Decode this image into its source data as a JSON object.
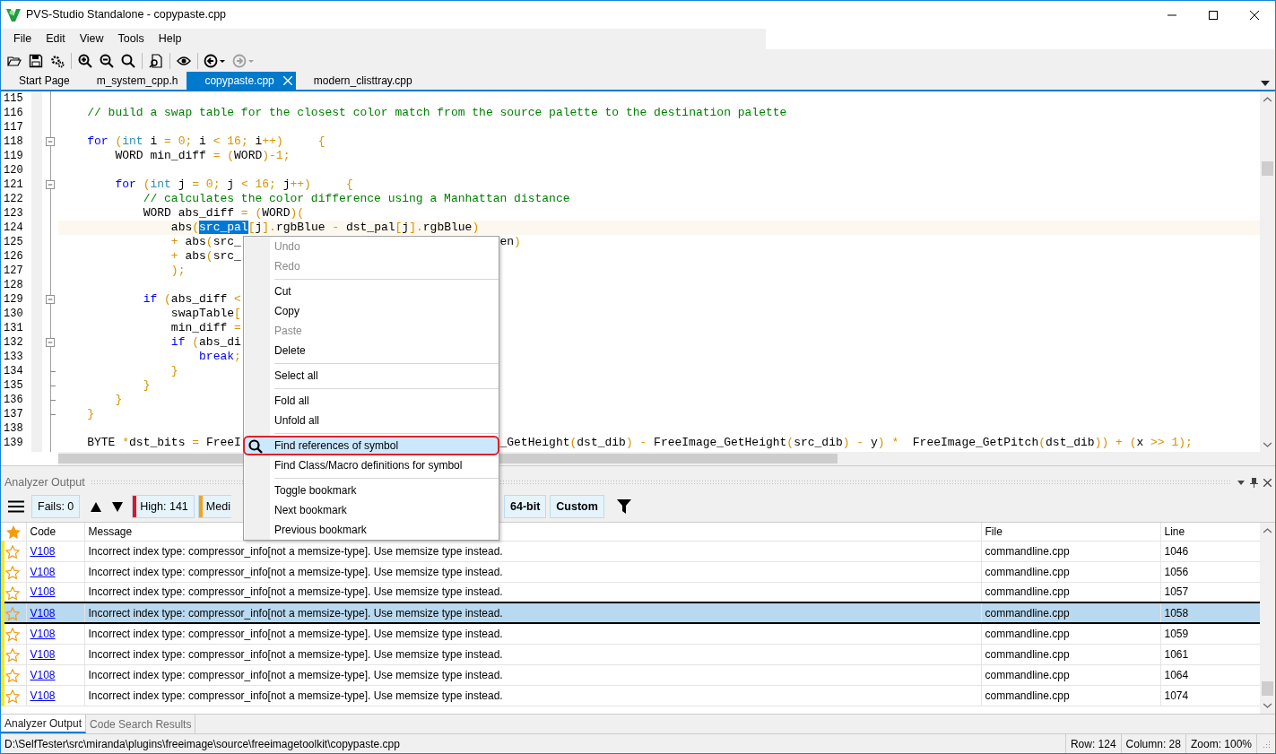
{
  "window": {
    "title": "PVS-Studio Standalone - copypaste.cpp"
  },
  "menu": [
    "File",
    "Edit",
    "View",
    "Tools",
    "Help"
  ],
  "history": {
    "back_disabled": false,
    "forward_disabled": true
  },
  "tabs": [
    {
      "label": "Start Page",
      "selected": false
    },
    {
      "label": "m_system_cpp.h",
      "selected": false
    },
    {
      "label": "copypaste.cpp",
      "selected": true
    },
    {
      "label": "modern_clisttray.cpp",
      "selected": false
    }
  ],
  "editor": {
    "lines": [
      {
        "number": "115"
      },
      {
        "number": "116",
        "segments": [
          {
            "text": "    // build a swap table for the closest color match from the source palette to the destination palette",
            "kind": "comment"
          }
        ]
      },
      {
        "number": "117"
      },
      {
        "number": "118",
        "fold_start": true,
        "segments": [
          {
            "text": "    for",
            "kind": "keyword"
          },
          {
            "text": " (",
            "kind": "punct"
          },
          {
            "text": "int",
            "kind": "type"
          },
          {
            "text": " i ",
            "kind": "plain"
          },
          {
            "text": "= 0;",
            "kind": "punct"
          },
          {
            "text": " i ",
            "kind": "plain"
          },
          {
            "text": "< 16;",
            "kind": "punct"
          },
          {
            "text": " i",
            "kind": "plain"
          },
          {
            "text": "++)     {",
            "kind": "punct"
          }
        ]
      },
      {
        "number": "119",
        "segments": [
          {
            "text": "        WORD min_diff ",
            "kind": "plain"
          },
          {
            "text": "= (",
            "kind": "punct"
          },
          {
            "text": "WORD",
            "kind": "plain"
          },
          {
            "text": ")-1;",
            "kind": "punct"
          }
        ]
      },
      {
        "number": "120"
      },
      {
        "number": "121",
        "fold_start": true,
        "segments": [
          {
            "text": "        for",
            "kind": "keyword"
          },
          {
            "text": " (",
            "kind": "punct"
          },
          {
            "text": "int",
            "kind": "type"
          },
          {
            "text": " j ",
            "kind": "plain"
          },
          {
            "text": "= 0;",
            "kind": "punct"
          },
          {
            "text": " j ",
            "kind": "plain"
          },
          {
            "text": "< 16;",
            "kind": "punct"
          },
          {
            "text": " j",
            "kind": "plain"
          },
          {
            "text": "++)     {",
            "kind": "punct"
          }
        ]
      },
      {
        "number": "122",
        "segments": [
          {
            "text": "            // calculates the color difference using a Manhattan distance",
            "kind": "comment"
          }
        ]
      },
      {
        "number": "123",
        "segments": [
          {
            "text": "            WORD abs_diff ",
            "kind": "plain"
          },
          {
            "text": "= (",
            "kind": "punct"
          },
          {
            "text": "WORD",
            "kind": "plain"
          },
          {
            "text": ")(",
            "kind": "punct"
          }
        ]
      },
      {
        "number": "124",
        "current": true,
        "segments": [
          {
            "text": "                abs",
            "kind": "plain"
          },
          {
            "text": "(",
            "kind": "punct"
          },
          {
            "text": "src_pal",
            "kind": "selection"
          },
          {
            "text": "[",
            "kind": "punct"
          },
          {
            "text": "j",
            "kind": "plain"
          },
          {
            "text": "].",
            "kind": "punct"
          },
          {
            "text": "rgbBlue ",
            "kind": "plain"
          },
          {
            "text": "-",
            "kind": "punct"
          },
          {
            "text": " dst_pal",
            "kind": "plain"
          },
          {
            "text": "[",
            "kind": "punct"
          },
          {
            "text": "j",
            "kind": "plain"
          },
          {
            "text": "].",
            "kind": "punct"
          },
          {
            "text": "rgbBlue",
            "kind": "plain"
          },
          {
            "text": ")",
            "kind": "punct"
          }
        ]
      },
      {
        "number": "125",
        "segments": [
          {
            "text": "                +",
            "kind": "punct"
          },
          {
            "text": " abs",
            "kind": "plain"
          },
          {
            "text": "(",
            "kind": "punct"
          },
          {
            "text": "src_",
            "kind": "plain"
          }
        ],
        "right": [
          {
            "text": "en",
            "kind": "plain"
          },
          {
            "text": ")",
            "kind": "punct"
          }
        ]
      },
      {
        "number": "126",
        "segments": [
          {
            "text": "                +",
            "kind": "punct"
          },
          {
            "text": " abs",
            "kind": "plain"
          },
          {
            "text": "(",
            "kind": "punct"
          },
          {
            "text": "src_",
            "kind": "plain"
          }
        ]
      },
      {
        "number": "127",
        "segments": [
          {
            "text": "                );",
            "kind": "punct"
          }
        ]
      },
      {
        "number": "128"
      },
      {
        "number": "129",
        "fold_start": true,
        "segments": [
          {
            "text": "            if",
            "kind": "keyword"
          },
          {
            "text": " (",
            "kind": "punct"
          },
          {
            "text": "abs_diff ",
            "kind": "plain"
          },
          {
            "text": "<",
            "kind": "punct"
          }
        ]
      },
      {
        "number": "130",
        "segments": [
          {
            "text": "                swapTable",
            "kind": "plain"
          },
          {
            "text": "[",
            "kind": "punct"
          }
        ]
      },
      {
        "number": "131",
        "segments": [
          {
            "text": "                min_diff ",
            "kind": "plain"
          },
          {
            "text": "=",
            "kind": "punct"
          }
        ]
      },
      {
        "number": "132",
        "fold_start": true,
        "segments": [
          {
            "text": "                if",
            "kind": "keyword"
          },
          {
            "text": " (",
            "kind": "punct"
          },
          {
            "text": "abs_di",
            "kind": "plain"
          }
        ]
      },
      {
        "number": "133",
        "segments": [
          {
            "text": "                    break",
            "kind": "keyword"
          },
          {
            "text": ";",
            "kind": "punct"
          }
        ]
      },
      {
        "number": "134",
        "fold_end": true,
        "segments": [
          {
            "text": "                }",
            "kind": "punct"
          }
        ]
      },
      {
        "number": "135",
        "fold_end": true,
        "segments": [
          {
            "text": "            }",
            "kind": "punct"
          }
        ]
      },
      {
        "number": "136",
        "fold_end": true,
        "segments": [
          {
            "text": "        }",
            "kind": "punct"
          }
        ]
      },
      {
        "number": "137",
        "fold_end": true,
        "segments": [
          {
            "text": "    }",
            "kind": "punct"
          }
        ]
      },
      {
        "number": "138"
      },
      {
        "number": "139",
        "segments": [
          {
            "text": "    BYTE ",
            "kind": "plain"
          },
          {
            "text": "*",
            "kind": "punct"
          },
          {
            "text": "dst_bits ",
            "kind": "plain"
          },
          {
            "text": "=",
            "kind": "punct"
          },
          {
            "text": " FreeI",
            "kind": "plain"
          }
        ],
        "right": [
          {
            "text": "_GetHeight",
            "kind": "plain"
          },
          {
            "text": "(",
            "kind": "punct"
          },
          {
            "text": "dst_dib",
            "kind": "plain"
          },
          {
            "text": ") -",
            "kind": "punct"
          },
          {
            "text": " FreeImage_GetHeight",
            "kind": "plain"
          },
          {
            "text": "(",
            "kind": "punct"
          },
          {
            "text": "src_dib",
            "kind": "plain"
          },
          {
            "text": ") -",
            "kind": "punct"
          },
          {
            "text": " y",
            "kind": "plain"
          },
          {
            "text": ") *",
            "kind": "punct"
          },
          {
            "text": "  FreeImage_GetPitch",
            "kind": "plain"
          },
          {
            "text": "(",
            "kind": "punct"
          },
          {
            "text": "dst_dib",
            "kind": "plain"
          },
          {
            "text": ")) + (",
            "kind": "punct"
          },
          {
            "text": "x ",
            "kind": "plain"
          },
          {
            "text": ">> 1);",
            "kind": "punct"
          }
        ]
      }
    ]
  },
  "context_menu": {
    "items": [
      {
        "kind": "item",
        "label": "Undo",
        "disabled": true,
        "selected": false
      },
      {
        "kind": "item",
        "label": "Redo",
        "disabled": true,
        "selected": false
      },
      {
        "kind": "separator"
      },
      {
        "kind": "item",
        "label": "Cut",
        "disabled": false,
        "selected": false
      },
      {
        "kind": "item",
        "label": "Copy",
        "disabled": false,
        "selected": false
      },
      {
        "kind": "item",
        "label": "Paste",
        "disabled": true,
        "selected": false
      },
      {
        "kind": "item",
        "label": "Delete",
        "disabled": false,
        "selected": false
      },
      {
        "kind": "separator"
      },
      {
        "kind": "item",
        "label": "Select all",
        "disabled": false,
        "selected": false
      },
      {
        "kind": "separator"
      },
      {
        "kind": "item",
        "label": "Fold all",
        "disabled": false,
        "selected": false
      },
      {
        "kind": "item",
        "label": "Unfold all",
        "disabled": false,
        "selected": false
      },
      {
        "kind": "separator"
      },
      {
        "kind": "item",
        "label": "Find references of symbol",
        "disabled": false,
        "selected": true,
        "icon": true
      },
      {
        "kind": "item",
        "label": "Find Class/Macro definitions for symbol",
        "disabled": false,
        "selected": false
      },
      {
        "kind": "separator"
      },
      {
        "kind": "item",
        "label": "Toggle bookmark",
        "disabled": false,
        "selected": false
      },
      {
        "kind": "item",
        "label": "Next bookmark",
        "disabled": false,
        "selected": false
      },
      {
        "kind": "item",
        "label": "Previous bookmark",
        "disabled": false,
        "selected": false
      }
    ]
  },
  "analyzer": {
    "title": "Analyzer Output",
    "fails": "Fails: 0",
    "filters": [
      {
        "kind": "level",
        "label": "High: 141",
        "color": "#e81123"
      },
      {
        "kind": "level",
        "label": "Medi",
        "color": "#f7a11a"
      },
      {
        "kind": "category",
        "label": "64-bit"
      },
      {
        "kind": "category",
        "label": "Custom"
      }
    ],
    "columns": [
      "Code",
      "Message",
      "File",
      "Line"
    ],
    "rows": [
      {
        "code": "V108",
        "message": "Incorrect index type: compressor_info[not a memsize-type]. Use memsize type instead.",
        "file": "commandline.cpp",
        "line": "1046",
        "selected": false
      },
      {
        "code": "V108",
        "message": "Incorrect index type: compressor_info[not a memsize-type]. Use memsize type instead.",
        "file": "commandline.cpp",
        "line": "1056",
        "selected": false
      },
      {
        "code": "V108",
        "message": "Incorrect index type: compressor_info[not a memsize-type]. Use memsize type instead.",
        "file": "commandline.cpp",
        "line": "1057",
        "selected": false
      },
      {
        "code": "V108",
        "message": "Incorrect index type: compressor_info[not a memsize-type]. Use memsize type instead.",
        "file": "commandline.cpp",
        "line": "1058",
        "selected": true
      },
      {
        "code": "V108",
        "message": "Incorrect index type: compressor_info[not a memsize-type]. Use memsize type instead.",
        "file": "commandline.cpp",
        "line": "1059",
        "selected": false
      },
      {
        "code": "V108",
        "message": "Incorrect index type: compressor_info[not a memsize-type]. Use memsize type instead.",
        "file": "commandline.cpp",
        "line": "1061",
        "selected": false
      },
      {
        "code": "V108",
        "message": "Incorrect index type: compressor_info[not a memsize-type]. Use memsize type instead.",
        "file": "commandline.cpp",
        "line": "1064",
        "selected": false
      },
      {
        "code": "V108",
        "message": "Incorrect index type: compressor_info[not a memsize-type]. Use memsize type instead.",
        "file": "commandline.cpp",
        "line": "1074",
        "selected": false
      }
    ]
  },
  "bottom_tabs": [
    {
      "label": "Analyzer Output",
      "selected": true
    },
    {
      "label": "Code Search Results",
      "selected": false
    }
  ],
  "status_bar": {
    "path": "D:\\SelfTester\\src\\miranda\\plugins\\freeimage\\source\\freeimagetoolkit\\copypaste.cpp",
    "row": "Row: 124",
    "column": "Column: 28",
    "zoom": "Zoom: 100%"
  }
}
